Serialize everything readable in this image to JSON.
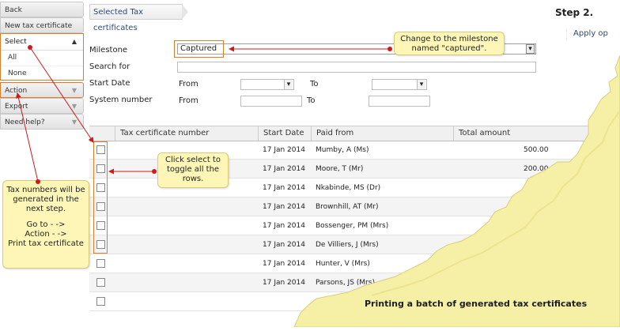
{
  "sidebar": {
    "back": "Back",
    "new_tax_certificate": "New tax certificate",
    "select": "Select",
    "select_options": [
      "All",
      "None"
    ],
    "action": "Action",
    "export": "Export",
    "help": "Need help?"
  },
  "header": {
    "tab_title": "Selected Tax certificates",
    "step": "Step 2.",
    "apply": "Apply op"
  },
  "form": {
    "milestone_label": "Milestone",
    "milestone_value": "Captured",
    "search_label": "Search for",
    "start_date_label": "Start Date",
    "system_number_label": "System number",
    "from": "From",
    "to": "To"
  },
  "table": {
    "columns": [
      "Tax certificate number",
      "Start Date",
      "Paid from",
      "Total amount"
    ],
    "rows": [
      {
        "start_date": "17 Jan 2014",
        "paid_from": "Mumby, A (Ms)",
        "amount": "500.00"
      },
      {
        "start_date": "17 Jan 2014",
        "paid_from": "Moore, T (Mr)",
        "amount": "200.00"
      },
      {
        "start_date": "17 Jan 2014",
        "paid_from": "Nkabinde, MS (Dr)",
        "amount": ""
      },
      {
        "start_date": "17 Jan 2014",
        "paid_from": "Brownhill, AT (Mr)",
        "amount": ""
      },
      {
        "start_date": "17 Jan 2014",
        "paid_from": "Bossenger, PM (Mrs)",
        "amount": ""
      },
      {
        "start_date": "17 Jan 2014",
        "paid_from": "De Villiers, J (Mrs)",
        "amount": ""
      },
      {
        "start_date": "17 Jan 2014",
        "paid_from": "Hunter, V (Mrs)",
        "amount": ""
      },
      {
        "start_date": "17 Jan 2014",
        "paid_from": "Parsons, JS (Mrs)",
        "amount": ""
      },
      {
        "start_date": "",
        "paid_from": "",
        "amount": ""
      }
    ]
  },
  "callouts": {
    "milestone_note": "Change to the milestone named \"captured\".",
    "select_note": "Click select to toggle all the rows.",
    "tax_note_1": "Tax numbers will be generated in the next step.",
    "tax_note_2": "Go to - ->",
    "tax_note_3": "Action - ->",
    "tax_note_4": "Print tax certificate"
  },
  "footer": "Printing a batch of generated tax certificates",
  "colors": {
    "accent": "#e07b2a",
    "arrow": "#d21818",
    "note": "#fdf6b7",
    "torn": "#f6f0a6"
  }
}
